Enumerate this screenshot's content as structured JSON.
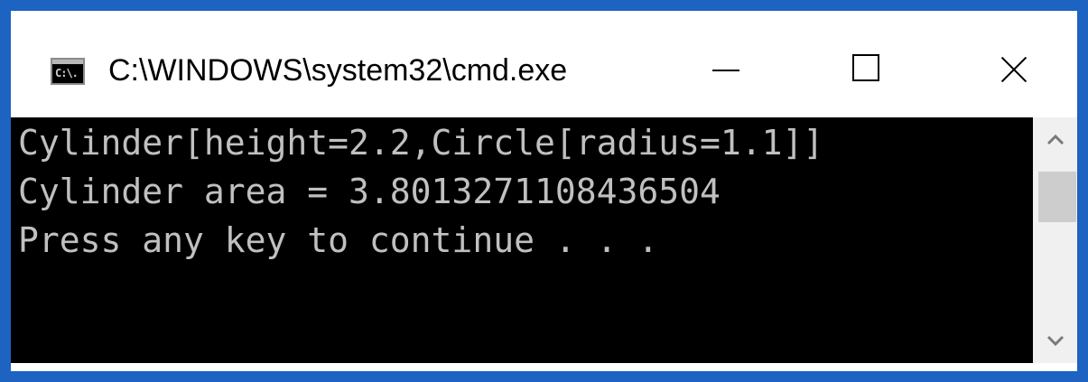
{
  "window": {
    "title": "C:\\WINDOWS\\system32\\cmd.exe",
    "icon_text": "C:\\.",
    "icon": "cmd-icon"
  },
  "controls": {
    "minimize": "minimize-icon",
    "maximize": "maximize-icon",
    "close": "close-icon"
  },
  "console": {
    "lines": [
      "Cylinder[height=2.2,Circle[radius=1.1]]",
      "Cylinder area = 3.8013271108436504",
      "Press any key to continue . . ."
    ]
  },
  "scrollbar": {
    "up_glyph": "^",
    "down_glyph": "v"
  },
  "colors": {
    "accent_border": "#1c63c2",
    "console_bg": "#000000",
    "console_text": "#c0c0c0"
  }
}
